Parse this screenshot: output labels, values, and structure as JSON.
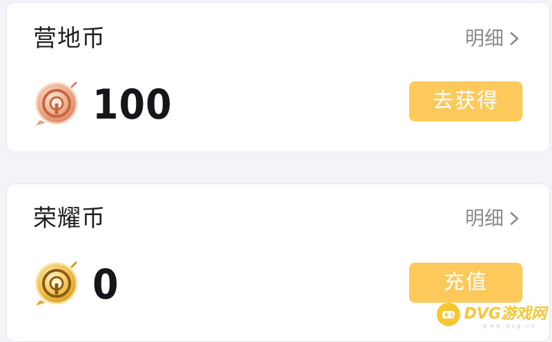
{
  "cards": [
    {
      "title": "营地币",
      "detail_label": "明细",
      "amount": "100",
      "action_label": "去获得",
      "icon": "camp-coin-icon"
    },
    {
      "title": "荣耀币",
      "detail_label": "明细",
      "amount": "0",
      "action_label": "充值",
      "icon": "honor-coin-icon"
    }
  ],
  "watermark": {
    "text": "DVG游戏网",
    "sub": "www.dvg.cn"
  },
  "colors": {
    "button_bg": "#fcc95a",
    "camp_coin": "#e9a27f",
    "honor_coin": "#f0c24a",
    "watermark": "#f6c429"
  }
}
